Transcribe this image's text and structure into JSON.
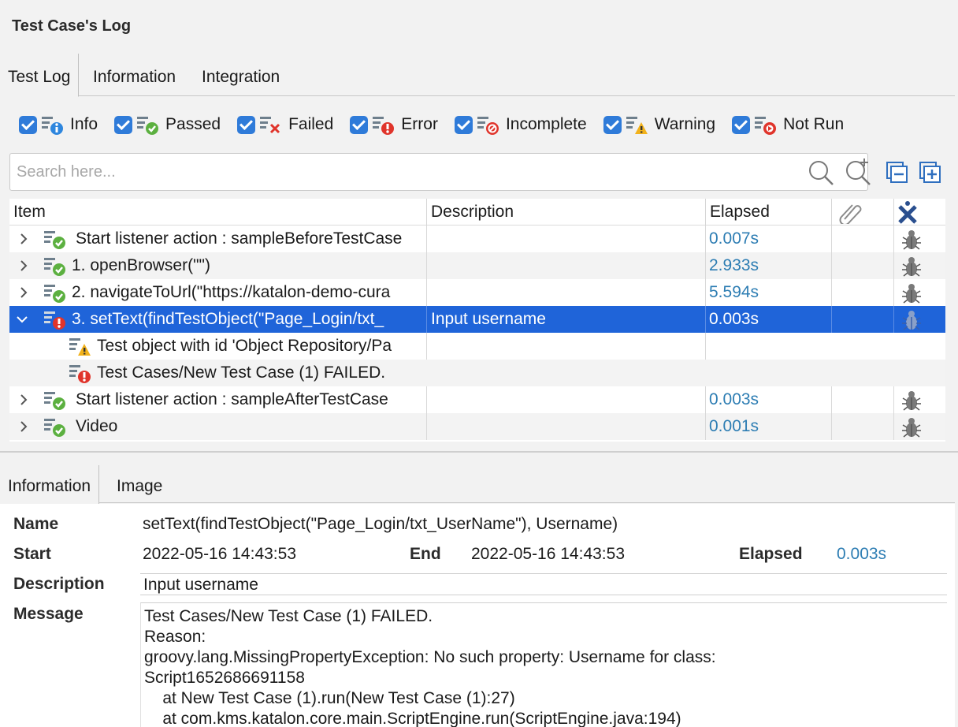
{
  "panel": {
    "title": "Test Case's Log"
  },
  "tabs": [
    {
      "label": "Test Log",
      "active": true
    },
    {
      "label": "Information",
      "active": false
    },
    {
      "label": "Integration",
      "active": false
    }
  ],
  "filters": [
    {
      "label": "Info",
      "checked": true,
      "icon": "info-icon"
    },
    {
      "label": "Passed",
      "checked": true,
      "icon": "passed-icon"
    },
    {
      "label": "Failed",
      "checked": true,
      "icon": "failed-icon"
    },
    {
      "label": "Error",
      "checked": true,
      "icon": "error-icon"
    },
    {
      "label": "Incomplete",
      "checked": true,
      "icon": "incomplete-icon"
    },
    {
      "label": "Warning",
      "checked": true,
      "icon": "warning-icon"
    },
    {
      "label": "Not Run",
      "checked": true,
      "icon": "not-run-icon"
    }
  ],
  "search": {
    "placeholder": "Search here..."
  },
  "table": {
    "columns": [
      "Item",
      "Description",
      "Elapsed"
    ],
    "rows": [
      {
        "item": "Start listener action : sampleBeforeTestCase",
        "description": "",
        "elapsed": "0.007s",
        "status": "passed",
        "expandable": true
      },
      {
        "item": "1. openBrowser(\"\")",
        "description": "",
        "elapsed": "2.933s",
        "status": "passed",
        "expandable": true
      },
      {
        "item": "2. navigateToUrl(\"https://katalon-demo-cura",
        "description": "",
        "elapsed": "5.594s",
        "status": "passed",
        "expandable": true
      },
      {
        "item": "3. setText(findTestObject(\"Page_Login/txt_",
        "description": "Input username",
        "elapsed": "0.003s",
        "status": "error",
        "expandable": true,
        "expanded": true,
        "selected": true
      },
      {
        "item": "Test object with id 'Object Repository/Pa",
        "description": "",
        "elapsed": "",
        "status": "warning",
        "child": true
      },
      {
        "item": "Test Cases/New Test Case (1) FAILED.",
        "description": "",
        "elapsed": "",
        "status": "error",
        "child": true
      },
      {
        "item": "Start listener action : sampleAfterTestCase",
        "description": "",
        "elapsed": "0.003s",
        "status": "passed",
        "expandable": true
      },
      {
        "item": "Video",
        "description": "",
        "elapsed": "0.001s",
        "status": "passed",
        "expandable": true
      }
    ]
  },
  "bottom_tabs": [
    {
      "label": "Information",
      "active": true
    },
    {
      "label": "Image",
      "active": false
    }
  ],
  "info": {
    "name_label": "Name",
    "name": "setText(findTestObject(\"Page_Login/txt_UserName\"), Username)",
    "start_label": "Start",
    "start": "2022-05-16 14:43:53",
    "end_label": "End",
    "end": "2022-05-16 14:43:53",
    "elapsed_label": "Elapsed",
    "elapsed": "0.003s",
    "description_label": "Description",
    "description": "Input username",
    "message_label": "Message",
    "message": "Test Cases/New Test Case (1) FAILED.\nReason:\ngroovy.lang.MissingPropertyException: No such property: Username for class:\nScript1652686691158\n    at New Test Case (1).run(New Test Case (1):27)\n    at com.kms.katalon.core.main.ScriptEngine.run(ScriptEngine.java:194)"
  },
  "colors": {
    "accent": "#2f7bd9",
    "selection": "#1f64d9",
    "elapsed_text": "#2d7db3",
    "passed": "#5cb040",
    "error": "#e0342b",
    "warning": "#f2b21b"
  }
}
